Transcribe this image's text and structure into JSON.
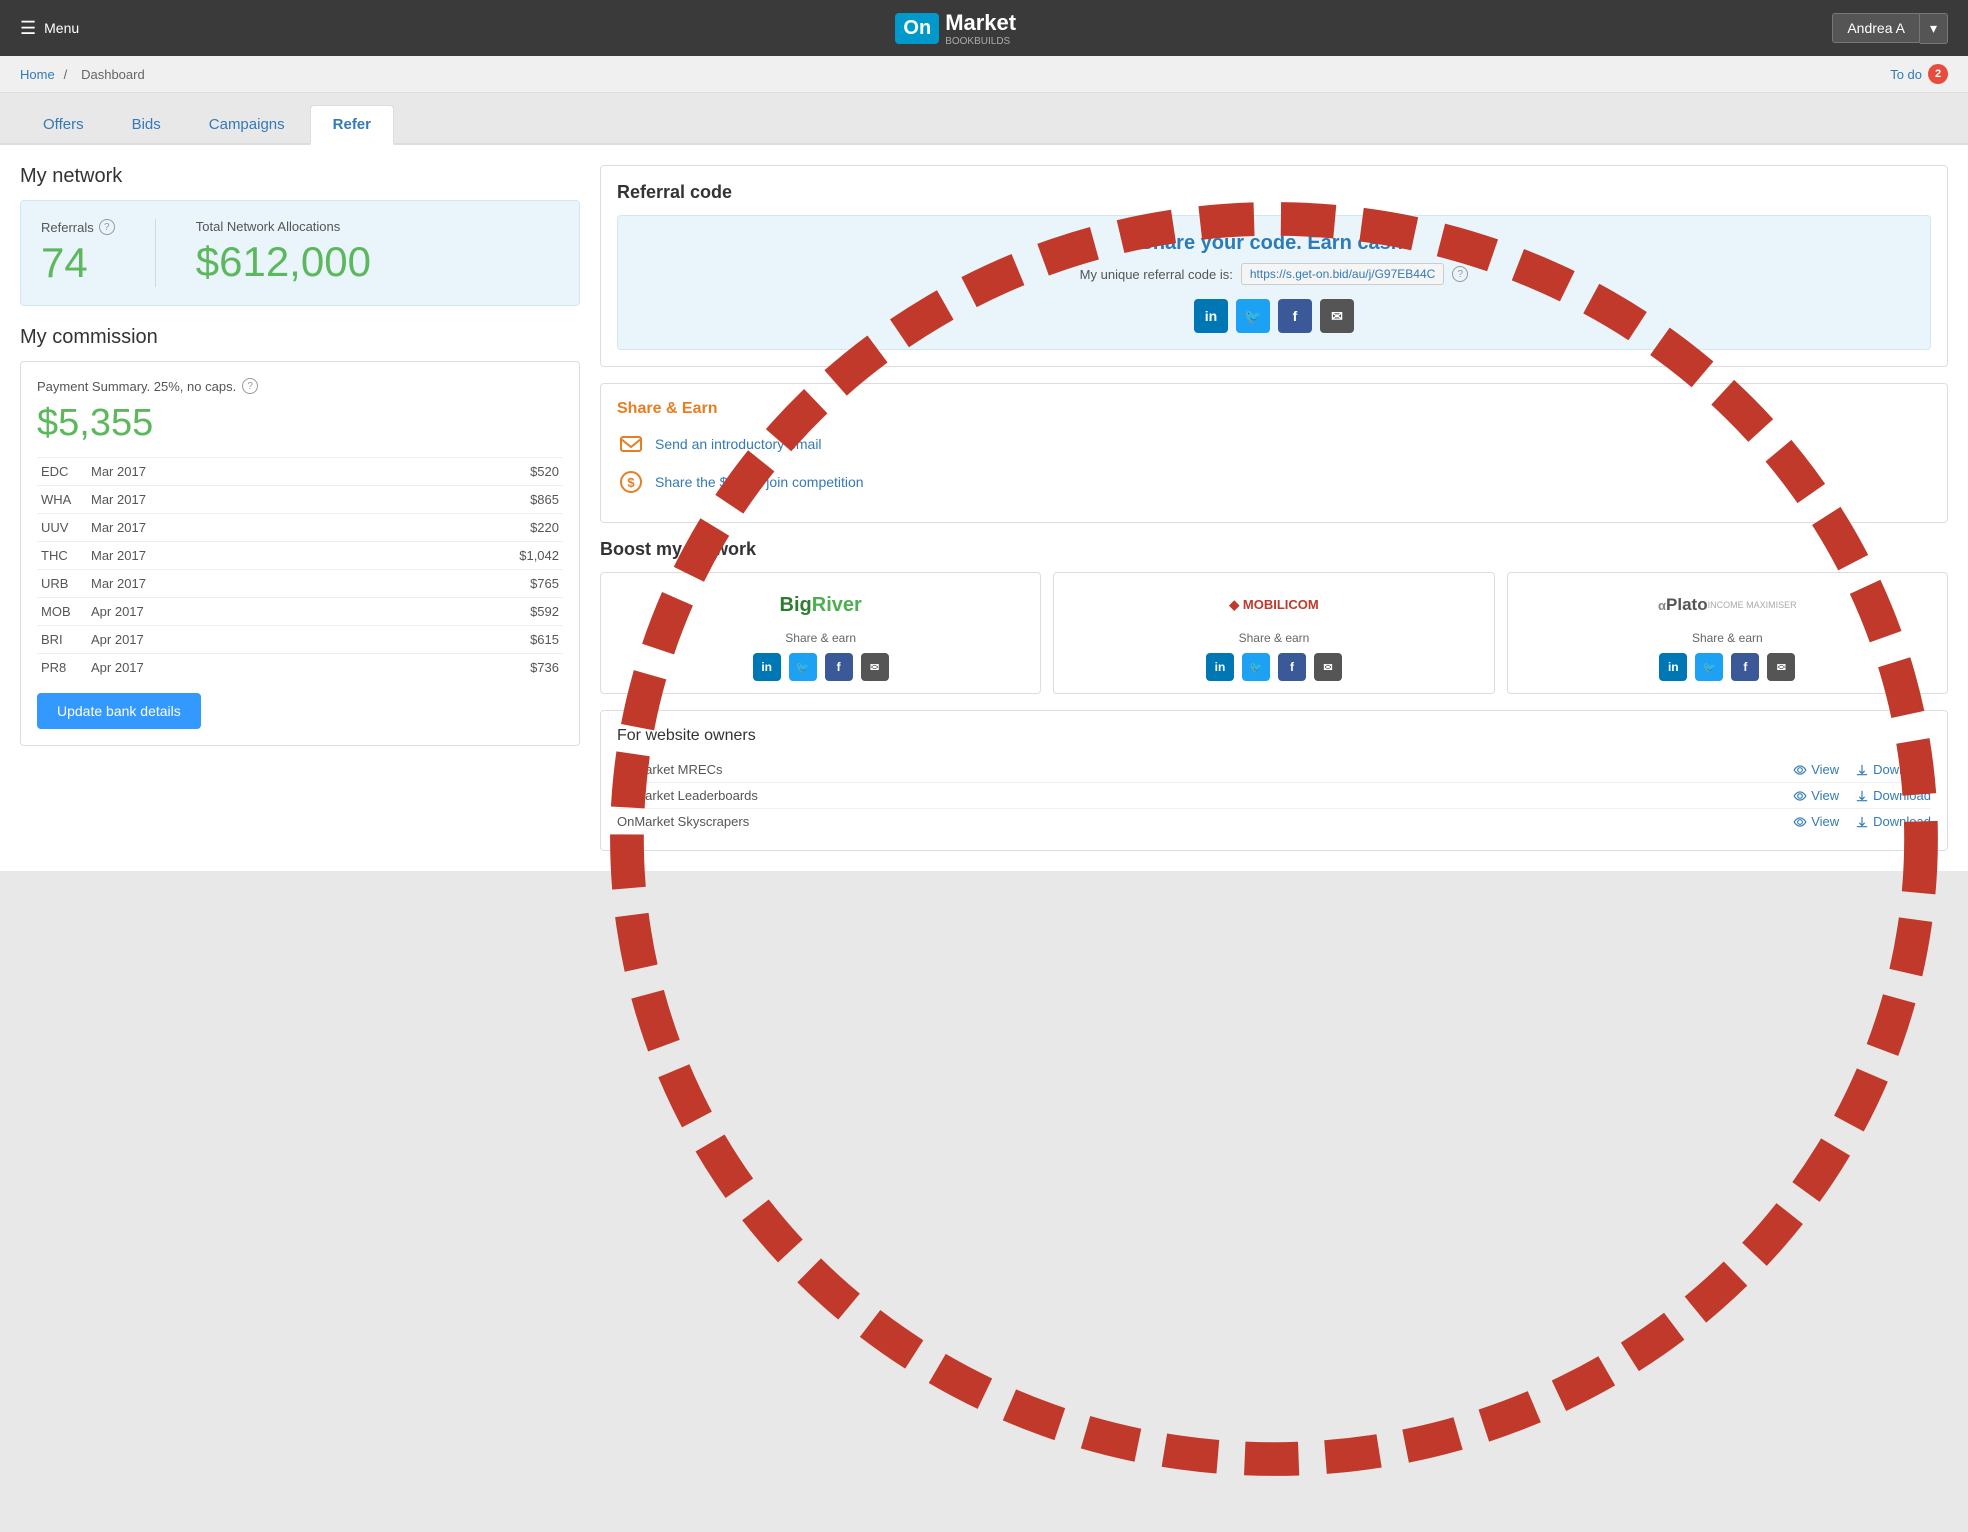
{
  "header": {
    "menu_label": "Menu",
    "logo_on": "On",
    "logo_market": "Market",
    "logo_sub": "BOOKBUILDS",
    "user_name": "Andrea A",
    "user_dropdown": "▾"
  },
  "breadcrumb": {
    "home": "Home",
    "separator": "/",
    "current": "Dashboard",
    "todo_label": "To do",
    "todo_count": "2"
  },
  "tabs": [
    {
      "label": "Offers",
      "active": false
    },
    {
      "label": "Bids",
      "active": false
    },
    {
      "label": "Campaigns",
      "active": false
    },
    {
      "label": "Refer",
      "active": true
    }
  ],
  "my_network": {
    "title": "My network",
    "referrals_label": "Referrals",
    "referrals_value": "74",
    "allocations_label": "Total Network Allocations",
    "allocations_value": "$612,000"
  },
  "my_commission": {
    "title": "My commission",
    "payment_summary": "Payment Summary. 25%, no caps.",
    "total_value": "$5,355",
    "rows": [
      {
        "code": "EDC",
        "period": "Mar 2017",
        "amount": "$520"
      },
      {
        "code": "WHA",
        "period": "Mar 2017",
        "amount": "$865"
      },
      {
        "code": "UUV",
        "period": "Mar 2017",
        "amount": "$220"
      },
      {
        "code": "THC",
        "period": "Mar 2017",
        "amount": "$1,042"
      },
      {
        "code": "URB",
        "period": "Mar 2017",
        "amount": "$765"
      },
      {
        "code": "MOB",
        "period": "Apr 2017",
        "amount": "$592"
      },
      {
        "code": "BRI",
        "period": "Apr 2017",
        "amount": "$615"
      },
      {
        "code": "PR8",
        "period": "Apr 2017",
        "amount": "$736"
      }
    ],
    "update_btn": "Update bank details"
  },
  "referral_code": {
    "title": "Referral code",
    "headline": "Share your code. Earn cash.",
    "code_prefix": "My unique referral code is:",
    "code_value": "https://s.get-on.bid/au/j/G97EB44C",
    "social": [
      "LinkedIn",
      "Twitter",
      "Facebook",
      "Email"
    ]
  },
  "share_earn": {
    "title": "Share & Earn",
    "items": [
      {
        "icon": "email-icon",
        "label": "Send an introductory email"
      },
      {
        "icon": "dollar-icon",
        "label": "Share the $2,000 join competition"
      }
    ]
  },
  "boost": {
    "title": "Boost my network",
    "cards": [
      {
        "name": "BigRiver",
        "label": "Share & earn"
      },
      {
        "name": "MOBILICOM",
        "label": "Share & earn"
      },
      {
        "name": "Plato",
        "label": "Share & earn"
      }
    ]
  },
  "website_owners": {
    "title": "For website owners",
    "rows": [
      {
        "name": "OnMarket MRECs",
        "view": "View",
        "download": "Download"
      },
      {
        "name": "OnMarket Leaderboards",
        "view": "View",
        "download": "Download"
      },
      {
        "name": "OnMarket Skyscrapers",
        "view": "View",
        "download": "Download"
      }
    ]
  }
}
